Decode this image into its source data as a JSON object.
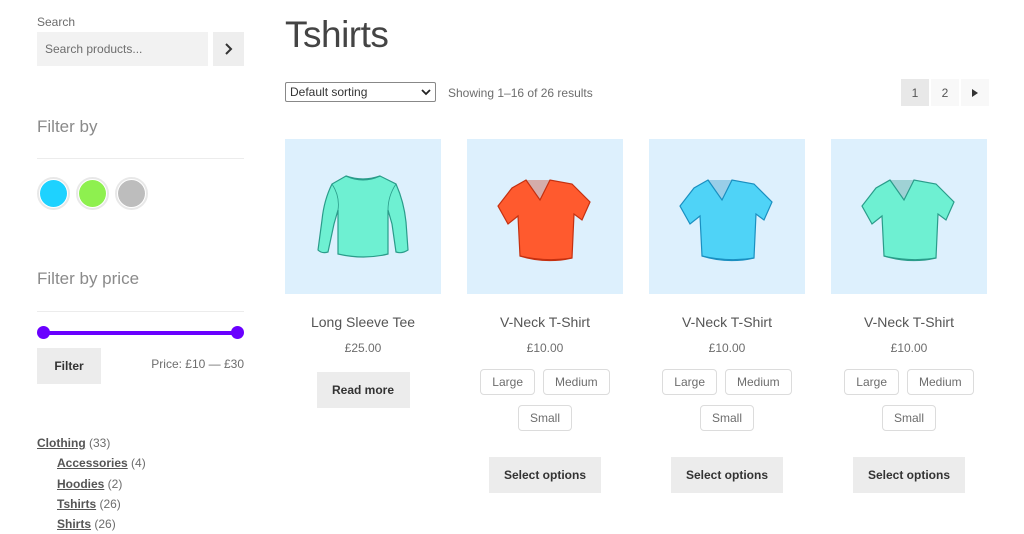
{
  "sidebar": {
    "search": {
      "label": "Search",
      "placeholder": "Search products...",
      "submit_icon": "chevron-right-icon"
    },
    "filter_by": {
      "title": "Filter by",
      "swatches": [
        {
          "name": "blue",
          "color": "#1ed2ff"
        },
        {
          "name": "green",
          "color": "#8ef04f"
        },
        {
          "name": "gray",
          "color": "#bdbdbd"
        }
      ]
    },
    "filter_by_price": {
      "title": "Filter by price",
      "slider_color": "#6a00ff",
      "min": 10,
      "max": 30,
      "selected_min": 10,
      "selected_max": 30,
      "filter_button": "Filter",
      "price_label": "Price: £10 — £30"
    },
    "categories": [
      {
        "name": "Clothing",
        "count": "(33)",
        "level": 0
      },
      {
        "name": "Accessories",
        "count": "(4)",
        "level": 1
      },
      {
        "name": "Hoodies",
        "count": "(2)",
        "level": 1
      },
      {
        "name": "Tshirts",
        "count": "(26)",
        "level": 1
      },
      {
        "name": "Shirts",
        "count": "(26)",
        "level": 1
      }
    ]
  },
  "main": {
    "title": "Tshirts",
    "sorting": {
      "selected": "Default sorting"
    },
    "result_count": "Showing 1–16 of 26 results",
    "pagination": {
      "pages": [
        "1",
        "2"
      ],
      "current": "1",
      "next_icon": "triangle-right-icon"
    },
    "products": [
      {
        "name": "Long Sleeve Tee",
        "price": "£25.00",
        "shirt_color": "#6ef0d2",
        "shirt_stroke": "#2a9c8a",
        "type": "long-sleeve",
        "attributes": [],
        "action": "Read more"
      },
      {
        "name": "V-Neck T-Shirt",
        "price": "£10.00",
        "shirt_color": "#ff5a2e",
        "shirt_stroke": "#c43010",
        "type": "v-neck",
        "attributes": [
          "Large",
          "Medium",
          "Small"
        ],
        "action": "Select options"
      },
      {
        "name": "V-Neck T-Shirt",
        "price": "£10.00",
        "shirt_color": "#4fd3f7",
        "shirt_stroke": "#1a8fc0",
        "type": "v-neck",
        "attributes": [
          "Large",
          "Medium",
          "Small"
        ],
        "action": "Select options"
      },
      {
        "name": "V-Neck T-Shirt",
        "price": "£10.00",
        "shirt_color": "#6ef0d2",
        "shirt_stroke": "#2a9c8a",
        "type": "v-neck",
        "attributes": [
          "Large",
          "Medium",
          "Small"
        ],
        "action": "Select options"
      }
    ]
  }
}
